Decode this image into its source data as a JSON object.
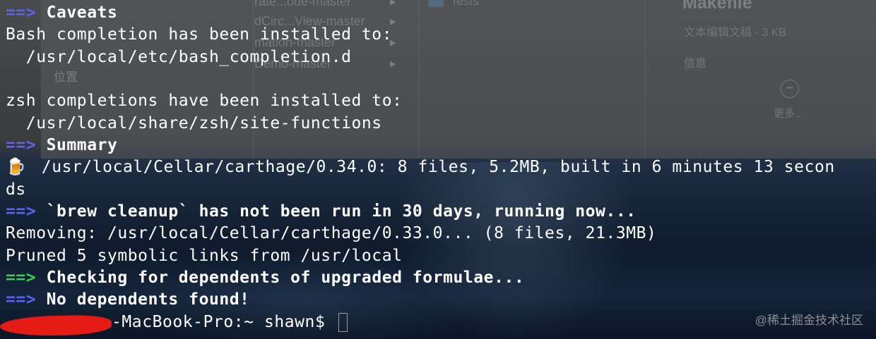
{
  "background": {
    "finder_rows": [
      "rate...ode-master",
      "dCirc...View-master",
      "mation-master",
      "Demo-master"
    ],
    "finder_sidebar_label": "位置",
    "finder_folder_name": "Tests",
    "preview_title": "Makefile",
    "preview_subtitle": "文本编辑文稿 - 3 KB",
    "preview_info": "信息",
    "preview_more_label": "更多..."
  },
  "terminal": {
    "arrow": "==>",
    "caveats_heading": "Caveats",
    "bash_line": "Bash completion has been installed to:",
    "bash_path": "  /usr/local/etc/bash_completion.d",
    "zsh_line": "zsh completions have been installed to:",
    "zsh_path": "  /usr/local/share/zsh/site-functions",
    "summary_heading": "Summary",
    "summary_line": "  /usr/local/Cellar/carthage/0.34.0: 8 files, 5.2MB, built in 6 minutes 13 secon",
    "summary_wrap": "ds",
    "cleanup_heading": "`brew cleanup` has not been run in 30 days, running now...",
    "removing_line": "Removing: /usr/local/Cellar/carthage/0.33.0... (8 files, 21.3MB)",
    "pruned_line": "Pruned 5 symbolic links from /usr/local",
    "checking_heading": "Checking for dependents of upgraded formulae...",
    "nodeps_heading": "No dependents found!",
    "prompt": "-MacBook-Pro:~ shawn$ "
  },
  "colors": {
    "arrow_blue": "#5b63f2",
    "arrow_green": "#36d24d",
    "redaction": "#e51c15"
  },
  "watermark": "@稀土掘金技术社区"
}
